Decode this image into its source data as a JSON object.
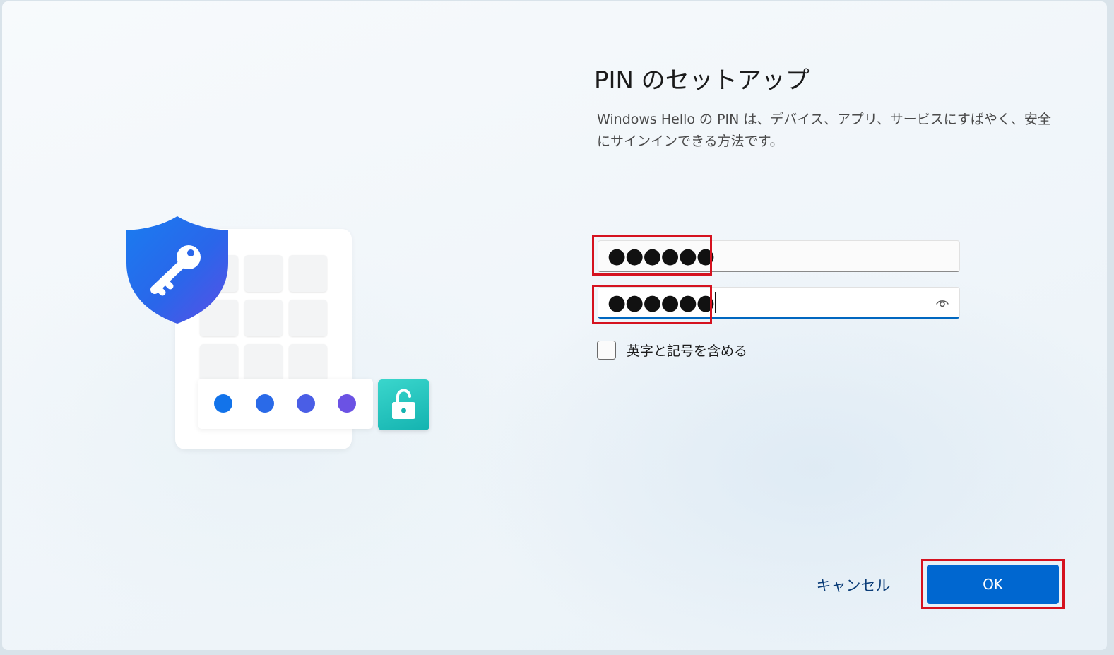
{
  "dialog": {
    "title": "PIN のセットアップ",
    "description": "Windows Hello の PIN は、デバイス、アプリ、サービスにすばやく、安全にサインインできる方法です。"
  },
  "pin_field": {
    "value": "●●●●●●"
  },
  "confirm_pin_field": {
    "value": "●●●●●●"
  },
  "include_letters_checkbox": {
    "label": "英字と記号を含める",
    "checked": false
  },
  "buttons": {
    "cancel_label": "キャンセル",
    "ok_label": "OK"
  },
  "colors": {
    "accent": "#0067d0",
    "highlight": "#d5121f",
    "pin_dots": [
      "#1273ea",
      "#2a6ae8",
      "#4a5ee6",
      "#6b52e4"
    ]
  },
  "icons": {
    "shield": "shield-key-icon",
    "unlock": "unlock-icon",
    "reveal": "eye-icon"
  }
}
